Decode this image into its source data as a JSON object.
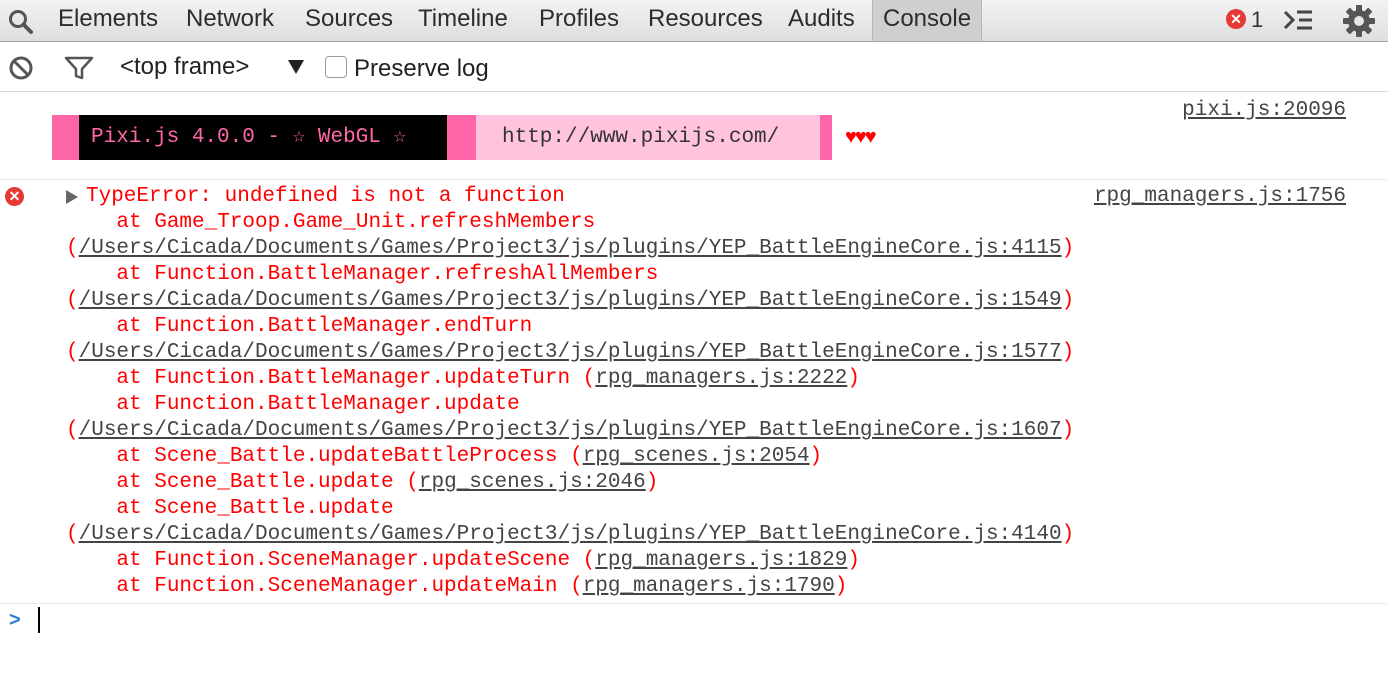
{
  "tabs": [
    "Elements",
    "Network",
    "Sources",
    "Timeline",
    "Profiles",
    "Resources",
    "Audits",
    "Console"
  ],
  "active_tab": "Console",
  "error_count": "1",
  "toolbar": {
    "frame": "<top frame>",
    "preserve_log": "Preserve log",
    "preserve_checked": false
  },
  "messages": {
    "pixi": {
      "source": "pixi.js:20096",
      "banner_left": "Pixi.js 4.0.0 - ☆ WebGL ☆",
      "banner_url": "http://www.pixijs.com/",
      "hearts": "♥♥♥"
    },
    "error": {
      "source": "rpg_managers.js:1756",
      "title": "TypeError: undefined is not a function",
      "lines": [
        {
          "pre": "    at Game_Troop.Game_Unit.refreshMembers",
          "link": "",
          "post": ""
        },
        {
          "pre": "(",
          "link": "/Users/Cicada/Documents/Games/Project3/js/plugins/YEP_BattleEngineCore.js:4115",
          "post": ")"
        },
        {
          "pre": "    at Function.BattleManager.refreshAllMembers",
          "link": "",
          "post": ""
        },
        {
          "pre": "(",
          "link": "/Users/Cicada/Documents/Games/Project3/js/plugins/YEP_BattleEngineCore.js:1549",
          "post": ")"
        },
        {
          "pre": "    at Function.BattleManager.endTurn",
          "link": "",
          "post": ""
        },
        {
          "pre": "(",
          "link": "/Users/Cicada/Documents/Games/Project3/js/plugins/YEP_BattleEngineCore.js:1577",
          "post": ")"
        },
        {
          "pre": "    at Function.BattleManager.updateTurn (",
          "link": "rpg_managers.js:2222",
          "post": ")"
        },
        {
          "pre": "    at Function.BattleManager.update",
          "link": "",
          "post": ""
        },
        {
          "pre": "(",
          "link": "/Users/Cicada/Documents/Games/Project3/js/plugins/YEP_BattleEngineCore.js:1607",
          "post": ")"
        },
        {
          "pre": "    at Scene_Battle.updateBattleProcess (",
          "link": "rpg_scenes.js:2054",
          "post": ")"
        },
        {
          "pre": "    at Scene_Battle.update (",
          "link": "rpg_scenes.js:2046",
          "post": ")"
        },
        {
          "pre": "    at Scene_Battle.update",
          "link": "",
          "post": ""
        },
        {
          "pre": "(",
          "link": "/Users/Cicada/Documents/Games/Project3/js/plugins/YEP_BattleEngineCore.js:4140",
          "post": ")"
        },
        {
          "pre": "    at Function.SceneManager.updateScene (",
          "link": "rpg_managers.js:1829",
          "post": ")"
        },
        {
          "pre": "    at Function.SceneManager.updateMain (",
          "link": "rpg_managers.js:1790",
          "post": ")"
        }
      ]
    }
  },
  "prompt_symbol": ">",
  "colors": {
    "error_red": "#ff0000",
    "banner_pink": "#ff66a8",
    "banner_light_pink": "#ffc3dd",
    "prompt_blue": "#2a7fd5"
  },
  "icons": [
    "search-icon",
    "error-icon",
    "console-drawer-icon",
    "gear-icon",
    "clear-icon",
    "filter-icon",
    "dropdown-arrow-icon",
    "expand-triangle-icon",
    "prompt-icon"
  ]
}
